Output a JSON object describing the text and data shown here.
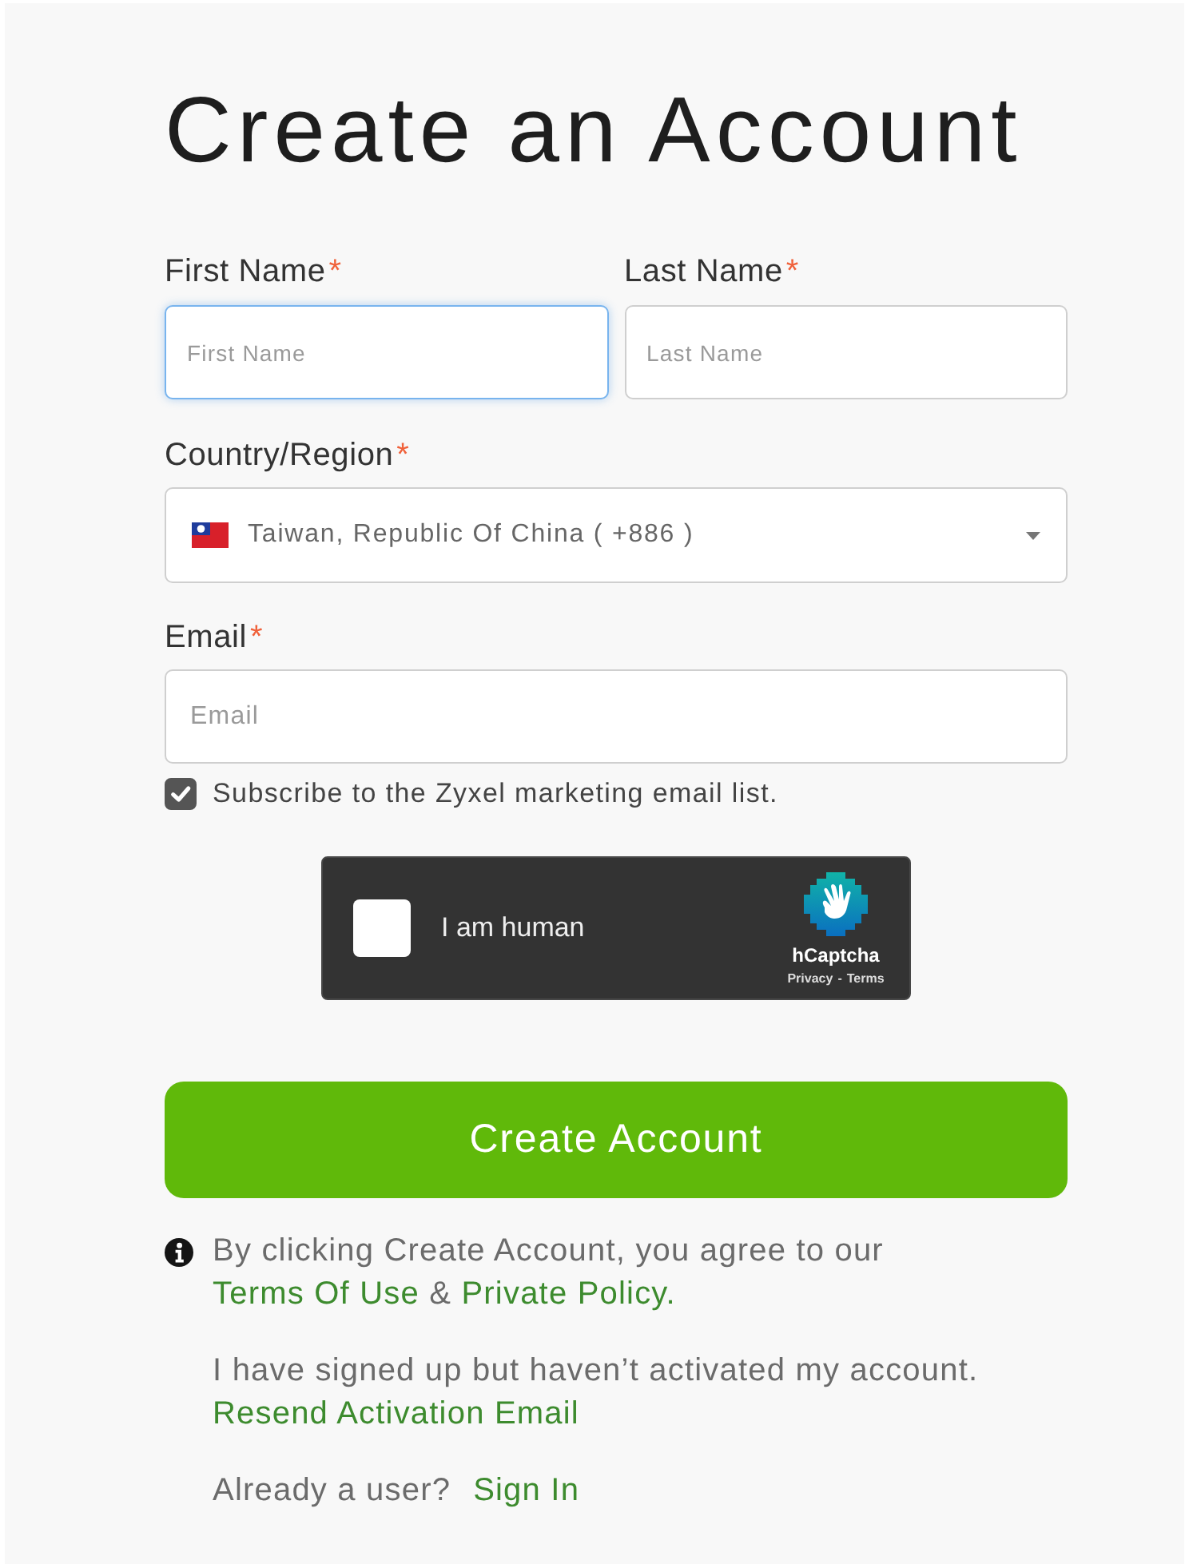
{
  "title": "Create an Account",
  "name_fields": [
    {
      "label": "First Name",
      "required_mark": "*",
      "placeholder": "First Name",
      "focused": true
    },
    {
      "label": "Last Name",
      "required_mark": "*",
      "placeholder": "Last Name",
      "focused": false
    }
  ],
  "country": {
    "label": "Country/Region",
    "required_mark": "*",
    "value": "Taiwan, Republic Of China ( +886 )"
  },
  "email": {
    "label": "Email",
    "required_mark": "*",
    "placeholder": "Email",
    "focused": false
  },
  "subscribe": {
    "label": "Subscribe to the Zyxel marketing email list.",
    "checked": true
  },
  "captcha": {
    "label": "I am human",
    "checked": false,
    "brand": "hCaptcha",
    "privacy_link": "Privacy",
    "separator": "-",
    "terms_link": "Terms"
  },
  "submit_button": {
    "label": "Create Account"
  },
  "consent": {
    "text": "By clicking Create Account, you agree to our",
    "terms_link": "Terms Of Use",
    "conjunction": "&",
    "policy_link": "Private Policy."
  },
  "activation": {
    "text": "I have signed up but haven’t activated my account.",
    "link": "Resend Activation Email"
  },
  "sign_in": {
    "text": "Already a user?",
    "link": "Sign In"
  }
}
